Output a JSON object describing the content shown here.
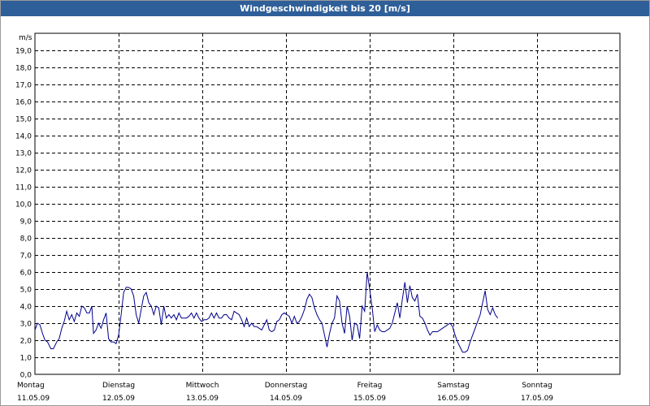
{
  "title": "Windgeschwindigkeit bis 20 [m/s]",
  "colors": {
    "titlebar": "#2f5f99",
    "series": "#00008c",
    "grid": "#000000"
  },
  "chart_data": {
    "type": "line",
    "title": "Windgeschwindigkeit bis 20 [m/s]",
    "ylabel": "m/s",
    "xlabel": "",
    "ylim": [
      0,
      20
    ],
    "y_ticks": [
      "0,0",
      "1,0",
      "2,0",
      "3,0",
      "4,0",
      "5,0",
      "6,0",
      "7,0",
      "8,0",
      "9,0",
      "10,0",
      "11,0",
      "12,0",
      "13,0",
      "14,0",
      "15,0",
      "16,0",
      "17,0",
      "18,0",
      "19,0"
    ],
    "x_range_days": [
      0,
      7
    ],
    "grid": "dashed",
    "x_categories": [
      {
        "day": "Montag",
        "date": "11.05.09"
      },
      {
        "day": "Dienstag",
        "date": "12.05.09"
      },
      {
        "day": "Mittwoch",
        "date": "13.05.09"
      },
      {
        "day": "Donnerstag",
        "date": "14.05.09"
      },
      {
        "day": "Freitag",
        "date": "15.05.09"
      },
      {
        "day": "Samstag",
        "date": "16.05.09"
      },
      {
        "day": "Sonntag",
        "date": "17.05.09"
      }
    ],
    "series": [
      {
        "color": "#00008c",
        "points": [
          [
            0.0,
            2.6
          ],
          [
            0.03,
            3.0
          ],
          [
            0.06,
            2.9
          ],
          [
            0.09,
            2.4
          ],
          [
            0.12,
            2.0
          ],
          [
            0.15,
            1.9
          ],
          [
            0.19,
            1.5
          ],
          [
            0.22,
            1.5
          ],
          [
            0.26,
            1.9
          ],
          [
            0.29,
            2.1
          ],
          [
            0.32,
            2.7
          ],
          [
            0.35,
            3.1
          ],
          [
            0.38,
            3.7
          ],
          [
            0.41,
            3.2
          ],
          [
            0.44,
            3.5
          ],
          [
            0.47,
            3.1
          ],
          [
            0.5,
            3.6
          ],
          [
            0.53,
            3.4
          ],
          [
            0.56,
            4.0
          ],
          [
            0.59,
            3.9
          ],
          [
            0.62,
            3.6
          ],
          [
            0.65,
            3.6
          ],
          [
            0.68,
            4.0
          ],
          [
            0.7,
            2.4
          ],
          [
            0.73,
            2.6
          ],
          [
            0.76,
            3.0
          ],
          [
            0.79,
            2.7
          ],
          [
            0.82,
            3.2
          ],
          [
            0.85,
            3.6
          ],
          [
            0.88,
            2.1
          ],
          [
            0.91,
            1.9
          ],
          [
            0.94,
            1.9
          ],
          [
            0.97,
            1.8
          ],
          [
            1.0,
            2.3
          ],
          [
            1.03,
            3.5
          ],
          [
            1.06,
            4.8
          ],
          [
            1.09,
            5.1
          ],
          [
            1.12,
            5.1
          ],
          [
            1.15,
            5.0
          ],
          [
            1.18,
            4.6
          ],
          [
            1.21,
            3.5
          ],
          [
            1.24,
            3.0
          ],
          [
            1.27,
            3.8
          ],
          [
            1.3,
            4.6
          ],
          [
            1.33,
            4.8
          ],
          [
            1.36,
            4.2
          ],
          [
            1.39,
            4.0
          ],
          [
            1.42,
            3.5
          ],
          [
            1.45,
            4.0
          ],
          [
            1.48,
            3.9
          ],
          [
            1.51,
            2.9
          ],
          [
            1.54,
            4.0
          ],
          [
            1.57,
            3.3
          ],
          [
            1.6,
            3.5
          ],
          [
            1.63,
            3.3
          ],
          [
            1.66,
            3.5
          ],
          [
            1.69,
            3.2
          ],
          [
            1.72,
            3.6
          ],
          [
            1.75,
            3.3
          ],
          [
            1.78,
            3.3
          ],
          [
            1.81,
            3.3
          ],
          [
            1.84,
            3.4
          ],
          [
            1.87,
            3.6
          ],
          [
            1.9,
            3.3
          ],
          [
            1.93,
            3.6
          ],
          [
            1.96,
            3.3
          ],
          [
            1.99,
            3.1
          ],
          [
            2.02,
            3.2
          ],
          [
            2.05,
            3.2
          ],
          [
            2.08,
            3.3
          ],
          [
            2.11,
            3.6
          ],
          [
            2.14,
            3.3
          ],
          [
            2.17,
            3.6
          ],
          [
            2.2,
            3.3
          ],
          [
            2.23,
            3.3
          ],
          [
            2.26,
            3.5
          ],
          [
            2.29,
            3.5
          ],
          [
            2.32,
            3.3
          ],
          [
            2.35,
            3.2
          ],
          [
            2.38,
            3.7
          ],
          [
            2.41,
            3.6
          ],
          [
            2.44,
            3.5
          ],
          [
            2.47,
            3.2
          ],
          [
            2.5,
            2.8
          ],
          [
            2.53,
            3.3
          ],
          [
            2.56,
            2.8
          ],
          [
            2.59,
            3.0
          ],
          [
            2.62,
            2.8
          ],
          [
            2.65,
            2.8
          ],
          [
            2.68,
            2.7
          ],
          [
            2.71,
            2.6
          ],
          [
            2.74,
            2.9
          ],
          [
            2.77,
            3.2
          ],
          [
            2.8,
            2.6
          ],
          [
            2.83,
            2.5
          ],
          [
            2.86,
            2.6
          ],
          [
            2.89,
            3.1
          ],
          [
            2.92,
            3.2
          ],
          [
            2.95,
            3.5
          ],
          [
            2.98,
            3.6
          ],
          [
            3.01,
            3.5
          ],
          [
            3.04,
            3.4
          ],
          [
            3.07,
            3.0
          ],
          [
            3.1,
            3.4
          ],
          [
            3.13,
            3.0
          ],
          [
            3.16,
            3.1
          ],
          [
            3.19,
            3.4
          ],
          [
            3.22,
            3.8
          ],
          [
            3.25,
            4.4
          ],
          [
            3.28,
            4.7
          ],
          [
            3.31,
            4.5
          ],
          [
            3.34,
            3.9
          ],
          [
            3.37,
            3.5
          ],
          [
            3.4,
            3.2
          ],
          [
            3.43,
            3.0
          ],
          [
            3.46,
            2.3
          ],
          [
            3.49,
            1.6
          ],
          [
            3.52,
            2.4
          ],
          [
            3.55,
            3.0
          ],
          [
            3.58,
            3.3
          ],
          [
            3.61,
            4.6
          ],
          [
            3.64,
            4.3
          ],
          [
            3.67,
            3.0
          ],
          [
            3.7,
            2.4
          ],
          [
            3.73,
            4.0
          ],
          [
            3.76,
            3.4
          ],
          [
            3.79,
            2.0
          ],
          [
            3.82,
            3.0
          ],
          [
            3.85,
            2.9
          ],
          [
            3.88,
            2.1
          ],
          [
            3.91,
            4.0
          ],
          [
            3.94,
            3.7
          ],
          [
            3.97,
            6.0
          ],
          [
            4.0,
            5.0
          ],
          [
            4.03,
            3.9
          ],
          [
            4.06,
            2.5
          ],
          [
            4.09,
            2.9
          ],
          [
            4.12,
            2.6
          ],
          [
            4.15,
            2.5
          ],
          [
            4.18,
            2.5
          ],
          [
            4.21,
            2.6
          ],
          [
            4.24,
            2.7
          ],
          [
            4.27,
            3.0
          ],
          [
            4.3,
            3.6
          ],
          [
            4.33,
            4.2
          ],
          [
            4.36,
            3.3
          ],
          [
            4.39,
            4.4
          ],
          [
            4.42,
            5.4
          ],
          [
            4.45,
            4.2
          ],
          [
            4.48,
            5.2
          ],
          [
            4.51,
            4.5
          ],
          [
            4.54,
            4.3
          ],
          [
            4.57,
            4.7
          ],
          [
            4.6,
            3.4
          ],
          [
            4.63,
            3.3
          ],
          [
            4.66,
            3.0
          ],
          [
            4.69,
            2.6
          ],
          [
            4.72,
            2.3
          ],
          [
            4.75,
            2.5
          ],
          [
            4.78,
            2.5
          ],
          [
            4.81,
            2.5
          ],
          [
            4.84,
            2.6
          ],
          [
            4.87,
            2.7
          ],
          [
            4.9,
            2.8
          ],
          [
            4.93,
            2.9
          ],
          [
            4.96,
            3.0
          ],
          [
            4.99,
            2.8
          ],
          [
            5.02,
            2.3
          ],
          [
            5.05,
            1.9
          ],
          [
            5.08,
            1.6
          ],
          [
            5.11,
            1.3
          ],
          [
            5.14,
            1.3
          ],
          [
            5.17,
            1.4
          ],
          [
            5.2,
            1.9
          ],
          [
            5.23,
            2.3
          ],
          [
            5.26,
            2.7
          ],
          [
            5.29,
            3.1
          ],
          [
            5.32,
            3.5
          ],
          [
            5.35,
            4.2
          ],
          [
            5.38,
            4.9
          ],
          [
            5.41,
            3.8
          ],
          [
            5.44,
            3.5
          ],
          [
            5.47,
            3.9
          ],
          [
            5.5,
            3.5
          ],
          [
            5.53,
            3.3
          ]
        ]
      }
    ]
  }
}
